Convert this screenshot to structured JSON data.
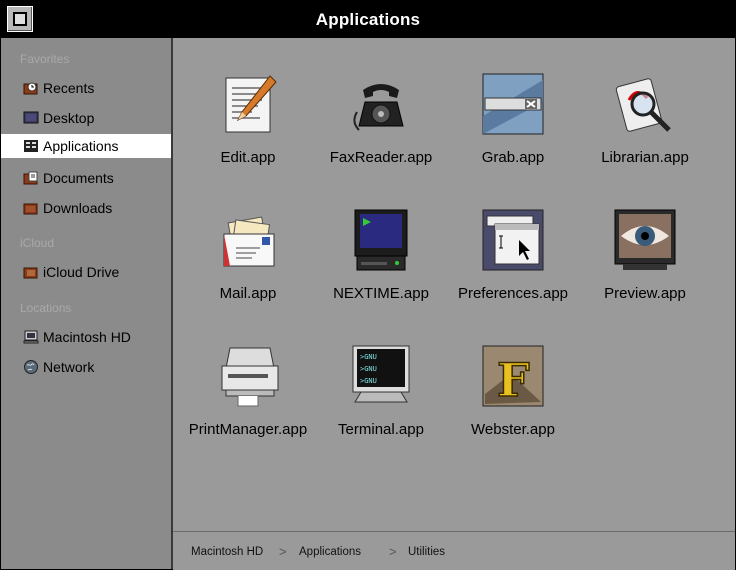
{
  "window": {
    "title": "Applications"
  },
  "sidebar": {
    "sections": [
      {
        "label": "Favorites"
      },
      {
        "label": "iCloud"
      },
      {
        "label": "Locations"
      }
    ],
    "items": [
      {
        "label": "Recents",
        "icon": "clock-folder-icon"
      },
      {
        "label": "Desktop",
        "icon": "desktop-icon"
      },
      {
        "label": "Applications",
        "icon": "applications-icon",
        "selected": true
      },
      {
        "label": "Documents",
        "icon": "documents-icon"
      },
      {
        "label": "Downloads",
        "icon": "downloads-icon"
      },
      {
        "label": "iCloud Drive",
        "icon": "cloud-folder-icon"
      },
      {
        "label": "Macintosh HD",
        "icon": "computer-icon"
      },
      {
        "label": "Network",
        "icon": "globe-icon"
      }
    ]
  },
  "apps": [
    {
      "name": "Edit.app",
      "icon": "edit-pen-icon"
    },
    {
      "name": "FaxReader.app",
      "icon": "telephone-icon"
    },
    {
      "name": "Grab.app",
      "icon": "grab-icon"
    },
    {
      "name": "Librarian.app",
      "icon": "librarian-magnifier-icon"
    },
    {
      "name": "Mail.app",
      "icon": "mail-envelope-icon"
    },
    {
      "name": "NEXTIME.app",
      "icon": "nextime-monitor-icon"
    },
    {
      "name": "Preferences.app",
      "icon": "preferences-windows-icon"
    },
    {
      "name": "Preview.app",
      "icon": "preview-eye-icon"
    },
    {
      "name": "PrintManager.app",
      "icon": "printer-icon"
    },
    {
      "name": "Terminal.app",
      "icon": "terminal-icon"
    },
    {
      "name": "Webster.app",
      "icon": "webster-f-icon"
    }
  ],
  "terminal_lines": [
    ">GNU",
    ">GNU",
    ">GNU"
  ],
  "webster_letter": "F",
  "pathbar": {
    "crumbs": [
      "Macintosh HD",
      "Applications",
      "Utilities"
    ],
    "separator": ">"
  },
  "colors": {
    "titlebar": "#000000",
    "sidebar": "#8b8b8b",
    "content": "#9a9a9a",
    "selection": "#ffffff"
  }
}
